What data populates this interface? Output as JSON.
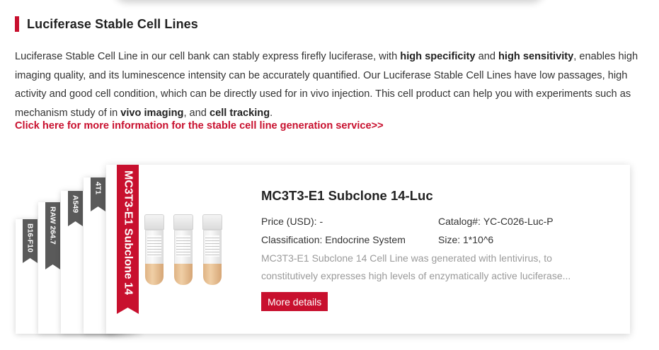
{
  "section": {
    "title": "Luciferase Stable Cell Lines"
  },
  "intro": {
    "p1": "Luciferase Stable Cell Line in our cell bank can stably express firefly luciferase, with ",
    "b1": "high specificity",
    "p2": " and ",
    "b2": "high sensitivity",
    "p3": ", enables high imaging quality, and its luminescence intensity can be accurately quantified. Our Luciferase Stable Cell Lines have low passages, high activity and good cell condition, which can be directly used for in vivo injection. This cell product can help you with experiments such as mechanism study of in ",
    "b3": "vivo imaging",
    "p4": ", and ",
    "b4": "cell tracking",
    "p5": "."
  },
  "service_link": "Click here for more information for the stable cell line generation service>>",
  "stack_tabs": [
    "B16-F10",
    "RAW 264.7",
    "A549",
    "4T1"
  ],
  "product": {
    "tab_label": "MC3T3-E1 Subclone 14",
    "title": "MC3T3-E1 Subclone 14-Luc",
    "price_label": "Price (USD):",
    "price_value": "-",
    "catalog_label": "Catalog#:",
    "catalog_value": "YC-C026-Luc-P",
    "classification_label": "Classification:",
    "classification_value": "Endocrine System",
    "size_label": "Size:",
    "size_value": "1*10^6",
    "description": "MC3T3-E1 Subclone 14 Cell Line was generated with lentivirus, to constitutively expresses high levels of enzymatically active luciferase...",
    "button_label": "More details",
    "image_icon": "cell-vials-icon"
  },
  "colors": {
    "accent": "#c8102e",
    "tab_gray": "#5a5a5a",
    "text": "#333333",
    "muted": "#9a9a9a"
  }
}
